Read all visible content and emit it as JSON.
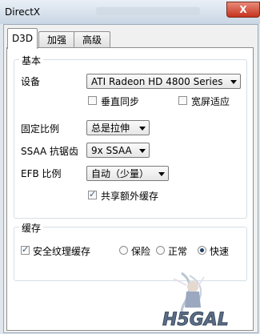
{
  "window": {
    "title": "DirectX",
    "close_symbol": "X"
  },
  "tabs": [
    "D3D",
    "加强",
    "高级"
  ],
  "basic_group": {
    "title": "基本",
    "device_label": "设备",
    "device_value": "ATI Radeon HD 4800 Series",
    "vsync_label": "垂直同步",
    "vsync_checked": false,
    "widescreen_label": "宽屏适应",
    "widescreen_checked": false,
    "aspect_label": "固定比例",
    "aspect_value": "总是拉伸",
    "ssaa_label": "SSAA 抗锯齿",
    "ssaa_value": "9x SSAA",
    "efb_label": "EFB 比例",
    "efb_value": "自动（少量）",
    "share_cache_label": "共享额外缓存",
    "share_cache_checked": true
  },
  "cache_group": {
    "title": "缓存",
    "safe_texture_label": "安全纹理缓存",
    "safe_texture_checked": true,
    "options": [
      "保险",
      "正常",
      "快速"
    ],
    "selected_option": "快速"
  },
  "logo": {
    "text": "H5GAL"
  },
  "colors": {
    "close_button": "#c5341f",
    "titlebar": "#c9d6e4",
    "accent": "#1c3d66"
  }
}
